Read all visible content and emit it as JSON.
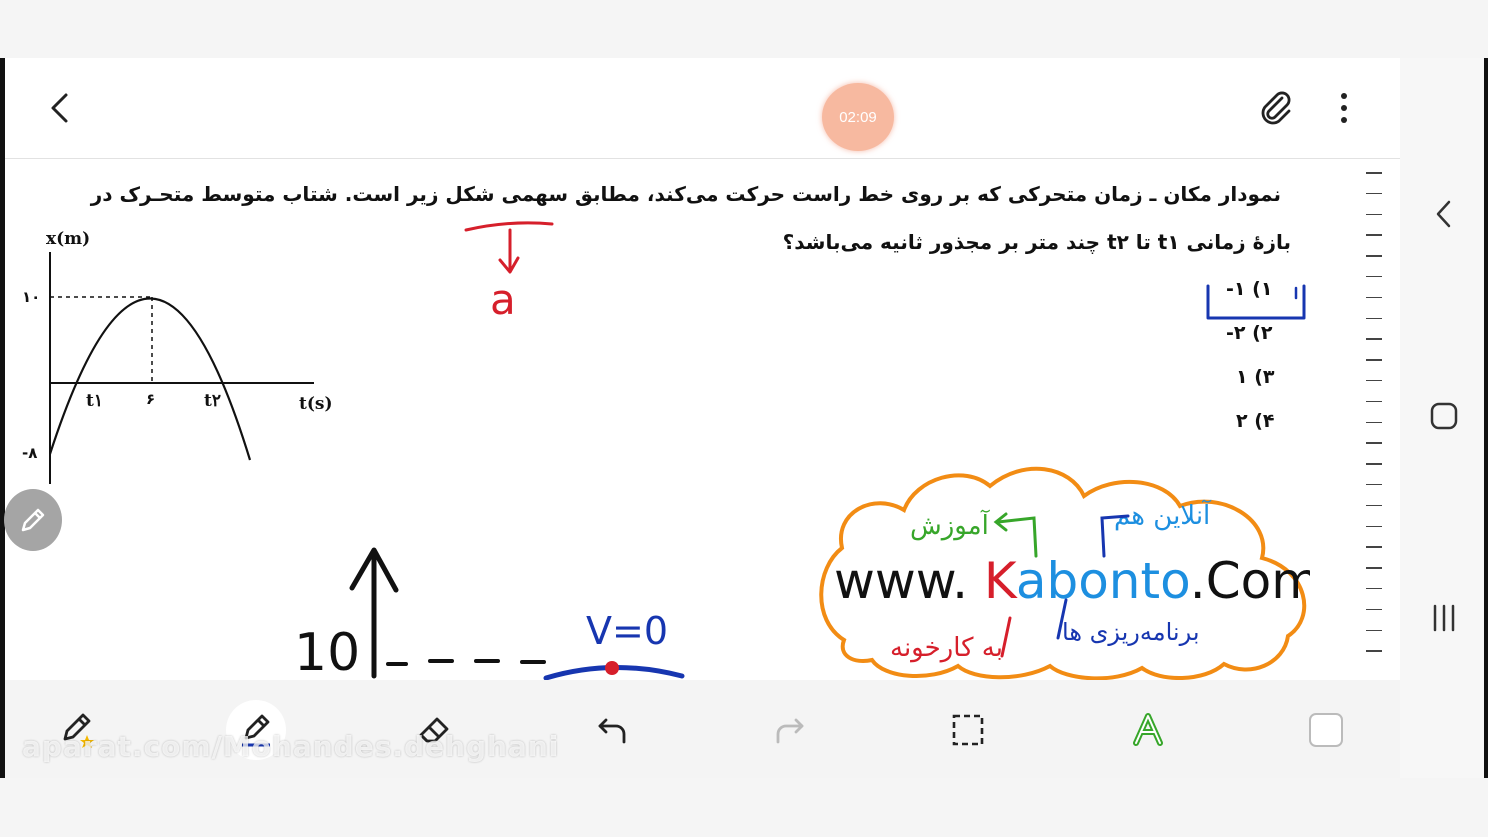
{
  "header": {
    "back_icon": "chevron-left-icon",
    "timer": "02:09",
    "attach_icon": "paperclip-icon",
    "more_icon": "more-vertical-icon"
  },
  "question": {
    "line1": "نمودار مکان ـ زمان متحرکی که بر روی خط راست حرکت می‌کند، مطابق سهمی شکل زیر است. شتاب متوسط متحـرک در",
    "line2": "بازهٔ زمانی t۱ تا t۲ چند متر بر مجذور ثانیه می‌باشد؟",
    "options": [
      "۱) ۱-",
      "۲) ۲-",
      "۳) ۱",
      "۴) ۲"
    ]
  },
  "graph": {
    "ylabel": "x(m)",
    "xlabel": "t(s)",
    "y_ticks": [
      "۱۰",
      "-۸"
    ],
    "x_ticks": [
      "t۱",
      "۶",
      "t۲"
    ]
  },
  "annotations": {
    "red_a": "a",
    "sketch_ten": "10",
    "sketch_v": "V=0"
  },
  "logo": {
    "url": "www. Kabonto .Com",
    "top_left": "آموزش",
    "top_right": "آنلاین هم",
    "bottom_left": "به کارخونه",
    "bottom_right": "برنامه‌ریزی ها"
  },
  "nav_icons": [
    "back-nav-icon",
    "home-nav-icon",
    "recents-nav-icon"
  ],
  "toolbar": {
    "tools": [
      "pen-star-icon",
      "pen-icon",
      "eraser-icon",
      "undo-icon",
      "redo-icon",
      "lasso-select-icon",
      "text-style-icon",
      "color-swatch-icon"
    ]
  },
  "watermark": "aparat.com/Mohandes.dehghani",
  "colors": {
    "timer": "#f7b9a0",
    "red_ink": "#d61f2b",
    "blue_ink": "#1736b0",
    "green_ink": "#37a62a",
    "orange_ink": "#f28c14"
  }
}
